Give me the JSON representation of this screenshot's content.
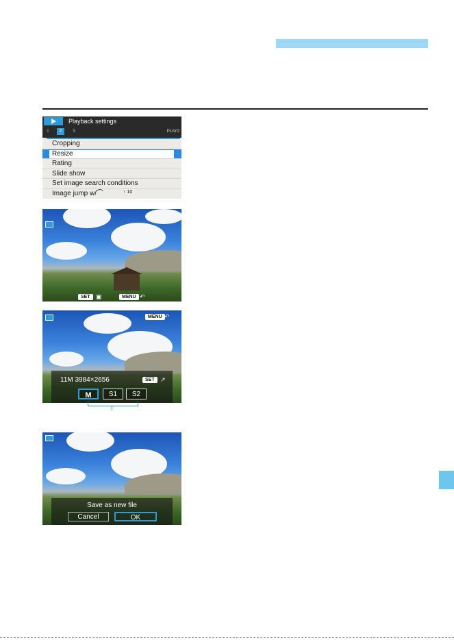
{
  "menu": {
    "title": "Playback settings",
    "tabs": [
      "1",
      "2",
      "3"
    ],
    "page_label": "PLAY2",
    "items": [
      "Cropping",
      "Resize",
      "Rating",
      "Slide show",
      "Set image search conditions",
      "Image jump w/⌒"
    ],
    "selected_item": "Resize",
    "jump_setting": "↑ 10"
  },
  "screen2": {
    "set_button": "SET",
    "menu_button": "MENU",
    "back_glyph": "↶",
    "resize_glyph": "▣"
  },
  "screen3": {
    "menu_button": "MENU",
    "back_glyph": "↶",
    "image_info": "11M 3984×2656",
    "set_button": "SET",
    "confirm_glyph": "↗",
    "sizes": [
      "M",
      "S1",
      "S2"
    ],
    "selected_size": "M"
  },
  "screen4": {
    "message": "Save as new file",
    "cancel_label": "Cancel",
    "ok_label": "OK"
  },
  "colors": {
    "accent": "#2d9bd8",
    "header_bar": "#9dd8f4",
    "side_tab": "#6ec6ee"
  }
}
